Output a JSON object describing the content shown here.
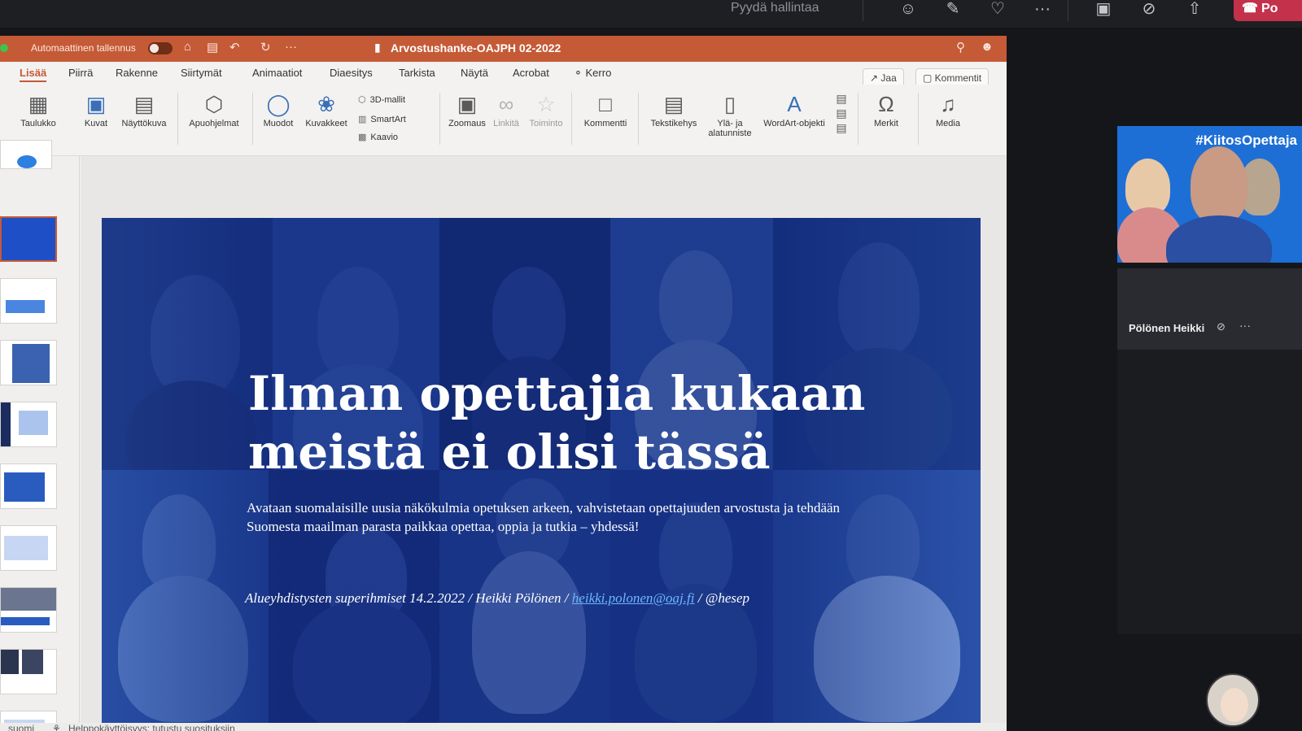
{
  "teams": {
    "request_control": "Pyydä hallintaa",
    "leave_label": "Po"
  },
  "ppt": {
    "autosave_label": "Automaattinen tallennus",
    "doc_title": "Arvostushanke-OAJPH 02-2022",
    "tabs": [
      "Lisää",
      "Piirrä",
      "Rakenne",
      "Siirtymät",
      "Animaatiot",
      "Diaesitys",
      "Tarkista",
      "Näytä",
      "Acrobat",
      "Kerro"
    ],
    "share_label": "Jaa",
    "comment_label": "Kommentit",
    "ribbon": {
      "table": "Taulukko",
      "pictures": "Kuvat",
      "screenshot": "Näyttökuva",
      "addins": "Apuohjelmat",
      "shapes": "Muodot",
      "icons": "Kuvakkeet",
      "models3d": "3D-mallit",
      "smartart": "SmartArt",
      "chart": "Kaavio",
      "zoom": "Zoomaus",
      "link": "Linkitä",
      "action": "Toiminto",
      "comment": "Kommentti",
      "textbox": "Tekstikehys",
      "header_line1": "Ylä- ja",
      "header_line2": "alatunniste",
      "wordart": "WordArt-objekti",
      "symbols": "Merkit",
      "media": "Media"
    },
    "slide": {
      "title_line1": "Ilman opettajia kukaan",
      "title_line2": "meistä ei olisi tässä",
      "subtitle": "Avataan suomalaisille uusia näkökulmia opetuksen arkeen, vahvistetaan opettajuuden arvostusta ja tehdään Suomesta maailman parasta paikkaa opettaa, oppia ja tutkia – yhdessä!",
      "footer_prefix": "Alueyhdistysten superihmiset 14.2.2022 / Heikki Pölönen / ",
      "footer_link": "heikki.polonen@oaj.fi",
      "footer_suffix": " / @hesep"
    },
    "statusbar": {
      "language": "suomi",
      "accessibility": "Helppokäyttöisyys: tutustu suosituksiin"
    }
  },
  "participants": {
    "video_tag": "#KiitosOpettaja",
    "presenter_name": "Pölönen Heikki"
  }
}
